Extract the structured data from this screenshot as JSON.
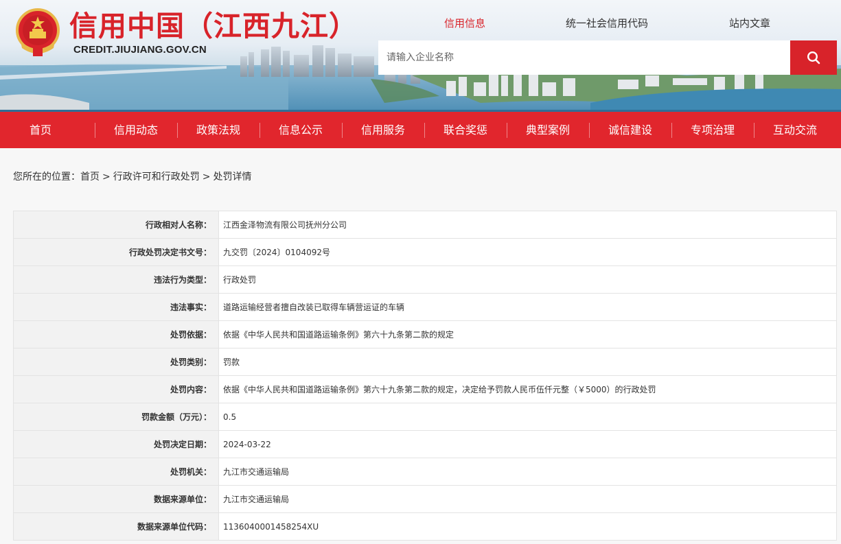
{
  "header": {
    "site_title": "信用中国（江西九江）",
    "site_url": "CREDIT.JIUJIANG.GOV.CN",
    "top_tabs": [
      {
        "label": "信用信息",
        "active": true
      },
      {
        "label": "统一社会信用代码",
        "active": false
      },
      {
        "label": "站内文章",
        "active": false
      }
    ],
    "search": {
      "placeholder": "请输入企业名称",
      "value": ""
    },
    "accent_color": "#d8232a"
  },
  "nav": {
    "items": [
      "首页",
      "信用动态",
      "政策法规",
      "信息公示",
      "信用服务",
      "联合奖惩",
      "典型案例",
      "诚信建设",
      "专项治理",
      "互动交流"
    ],
    "color": "#e1262d"
  },
  "breadcrumb": {
    "prefix": "您所在的位置：",
    "items": [
      "首页",
      "行政许可和行政处罚",
      "处罚详情"
    ],
    "separator": ">"
  },
  "detail": {
    "rows": [
      {
        "label": "行政相对人名称：",
        "value": "江西金泽物流有限公司抚州分公司"
      },
      {
        "label": "行政处罚决定书文号：",
        "value": "九交罚〔2024〕0104092号"
      },
      {
        "label": "违法行为类型：",
        "value": "行政处罚"
      },
      {
        "label": "违法事实：",
        "value": "道路运输经营者擅自改装已取得车辆营运证的车辆"
      },
      {
        "label": "处罚依据：",
        "value": "依据《中华人民共和国道路运输条例》第六十九条第二款的规定"
      },
      {
        "label": "处罚类别：",
        "value": "罚款"
      },
      {
        "label": "处罚内容：",
        "value": "依据《中华人民共和国道路运输条例》第六十九条第二款的规定，决定给予罚款人民币伍仟元整（￥5000）的行政处罚"
      },
      {
        "label": "罚款金额（万元）：",
        "value": "0.5"
      },
      {
        "label": "处罚决定日期：",
        "value": "2024-03-22"
      },
      {
        "label": "处罚机关：",
        "value": "九江市交通运输局"
      },
      {
        "label": "数据来源单位：",
        "value": "九江市交通运输局"
      },
      {
        "label": "数据来源单位代码：",
        "value": "11360400014582​54XU"
      }
    ]
  }
}
